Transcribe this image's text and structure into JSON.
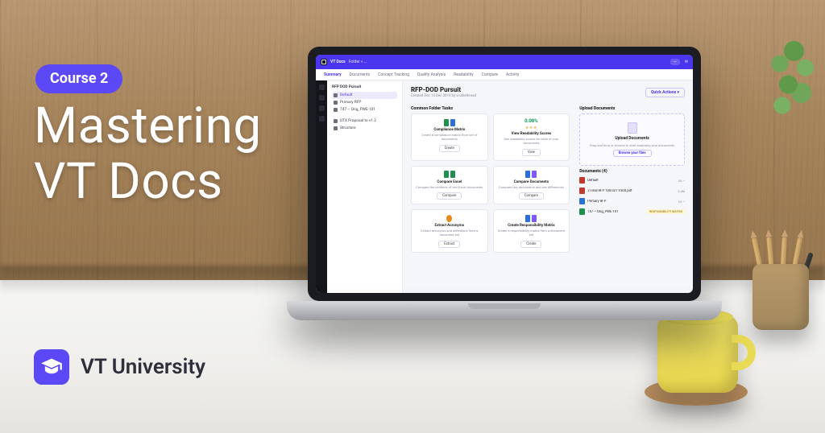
{
  "course_badge": "Course 2",
  "hero_title": "Mastering\nVT Docs",
  "brand_name": "VT University",
  "colors": {
    "accent": "#5b48f6"
  },
  "app": {
    "product_name": "VT Docs",
    "breadcrumb": "Folder » …",
    "header_chip": "—",
    "header_email": "✉",
    "tabs": [
      {
        "label": "Summary",
        "active": true
      },
      {
        "label": "Documents"
      },
      {
        "label": "Concept Tracking"
      },
      {
        "label": "Quality Analysis"
      },
      {
        "label": "Readability"
      },
      {
        "label": "Compare"
      },
      {
        "label": "Activity"
      }
    ],
    "sidebar": {
      "header": "RFP DOD Pursuit",
      "items": [
        {
          "label": "Default",
          "active": true
        },
        {
          "label": "Primary RFP"
        },
        {
          "label": "747 – Orig_PWE-101"
        }
      ],
      "group2": [
        {
          "label": "UTX Proposal to v1.2"
        },
        {
          "label": "Structure"
        }
      ]
    },
    "page": {
      "title": "RFP-DOD Pursuit",
      "subtitle": "Created Dec 14 Dec 2019 by visiblethread",
      "quick_actions_label": "Quick Actions  ▾"
    },
    "common_tasks_header": "Common Folder Tasks",
    "upload_header": "Upload Documents",
    "upload": {
      "title": "Upload Documents",
      "desc": "Drag and drop or browse to start analysing your documents",
      "button": "Browse your files"
    },
    "cards": [
      {
        "title": "Compliance Matrix",
        "desc": "Create a compliance matrix from set of documents",
        "button": "Create",
        "icon": [
          "green",
          "blue"
        ]
      },
      {
        "title": "View Readability Scores",
        "percent": "0.00%",
        "stars": "★★★",
        "desc": "See readability scores for each of your documents",
        "button": "View"
      },
      {
        "title": "Compare Excel",
        "desc": "Compare the contents of two Excel documents",
        "button": "Compare",
        "icon": [
          "green",
          "green"
        ]
      },
      {
        "title": "Compare Documents",
        "desc": "Compare two documents and see differences",
        "button": "Compare",
        "icon": [
          "blue",
          "purple"
        ]
      },
      {
        "title": "Extract Acronyms",
        "desc": "Extract acronyms and definitions from a document set",
        "button": "Extract",
        "icon": [
          "orange"
        ]
      },
      {
        "title": "Create Responsibility Matrix",
        "desc": "Create a responsibility matrix from a document set",
        "button": "Create",
        "icon": [
          "blue",
          "purple"
        ]
      }
    ],
    "documents_header": "Documents (4)",
    "documents": [
      {
        "name": "Default",
        "meta": "04  —",
        "color": "#c23a2e"
      },
      {
        "name": "3 Final RFP 100.021 V304.pdf",
        "meta": "04  —",
        "color": "#c23a2e",
        "size": "3.4M"
      },
      {
        "name": "Primary RFP",
        "meta": "04  —",
        "color": "#2b6fd8"
      },
      {
        "name": "747 – Orig_PWE-101",
        "meta": "—",
        "color": "#1f8f4d",
        "badge": "RESPONSIBILITY MATRIX"
      }
    ]
  }
}
